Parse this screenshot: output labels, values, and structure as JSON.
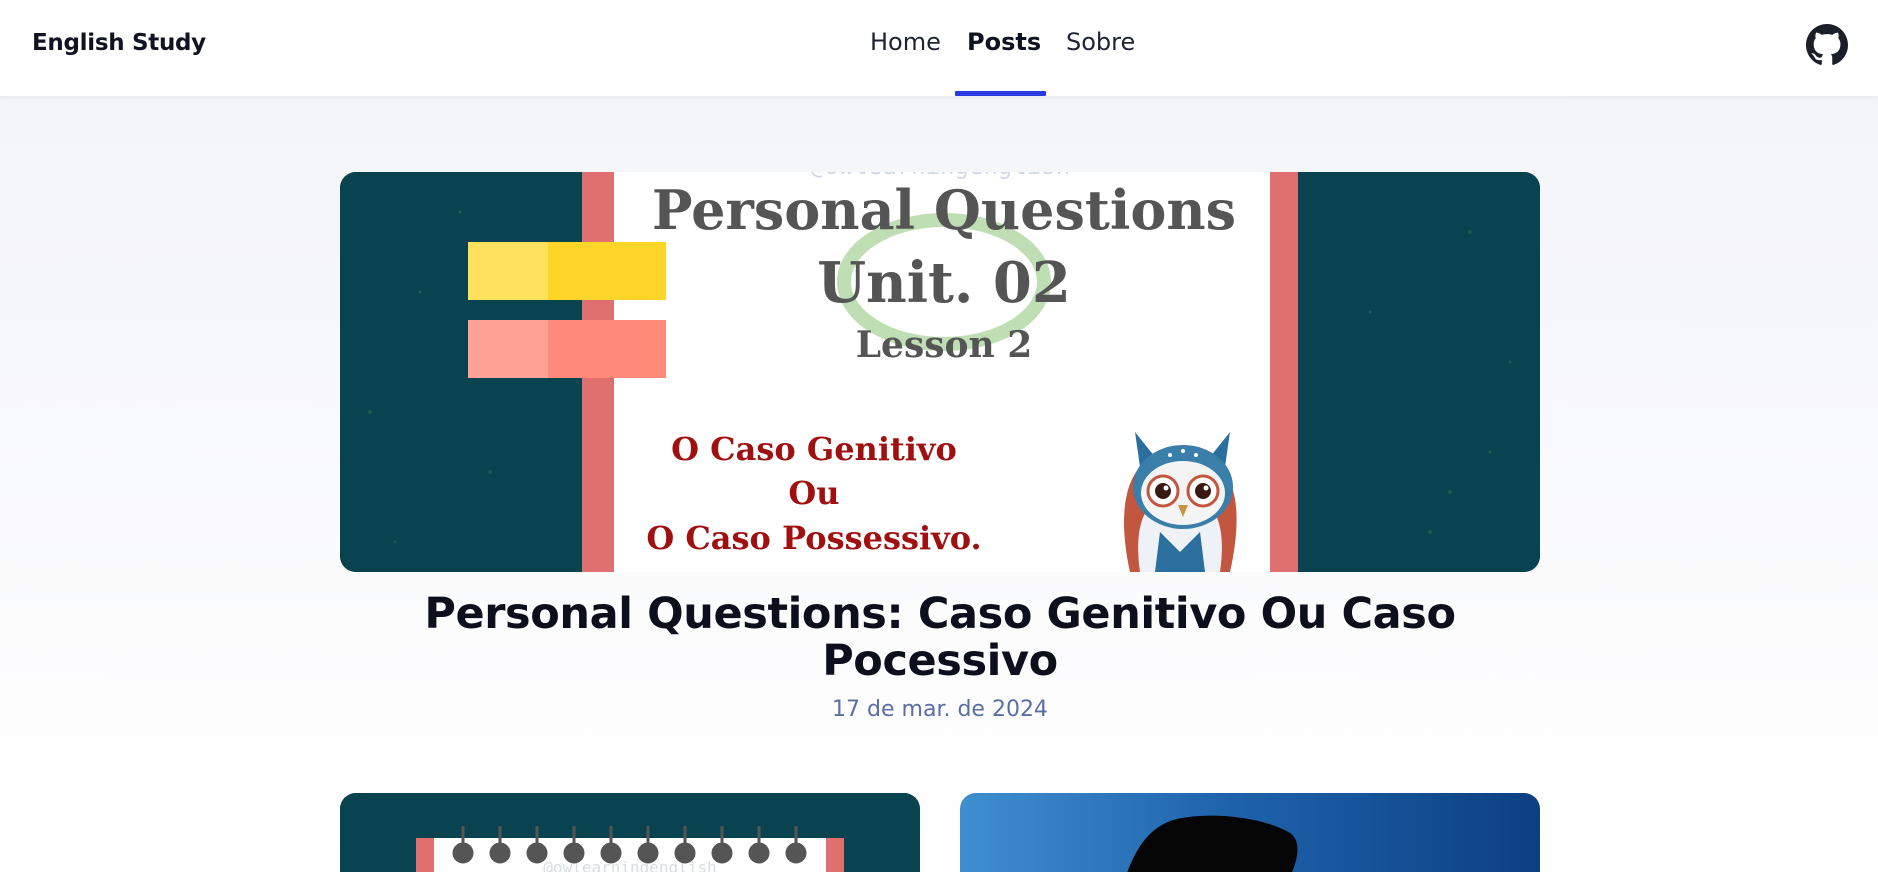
{
  "header": {
    "brand": "English Study",
    "nav": [
      {
        "label": "Home",
        "active": false
      },
      {
        "label": "Posts",
        "active": true
      },
      {
        "label": "Sobre",
        "active": false
      }
    ],
    "github_icon": "github-icon",
    "accent_color": "#2b3be4"
  },
  "featured_post": {
    "image": {
      "watermark": "@owlearningenglish",
      "title_line1": "Personal Questions",
      "title_line2": "Unit. 02",
      "subtitle": "Lesson 2",
      "red_line1": "O Caso Genitivo",
      "red_line2": "Ou",
      "red_line3": "O Caso Possessivo.",
      "mascot": "owl-mascot"
    },
    "title": "Personal Questions: Caso Genitivo Ou Caso Pocessivo",
    "date": "17 de mar. de 2024"
  },
  "post_cards": [
    {
      "image": {
        "watermark": "@owlearningenglish"
      }
    },
    {
      "image": {}
    }
  ]
}
